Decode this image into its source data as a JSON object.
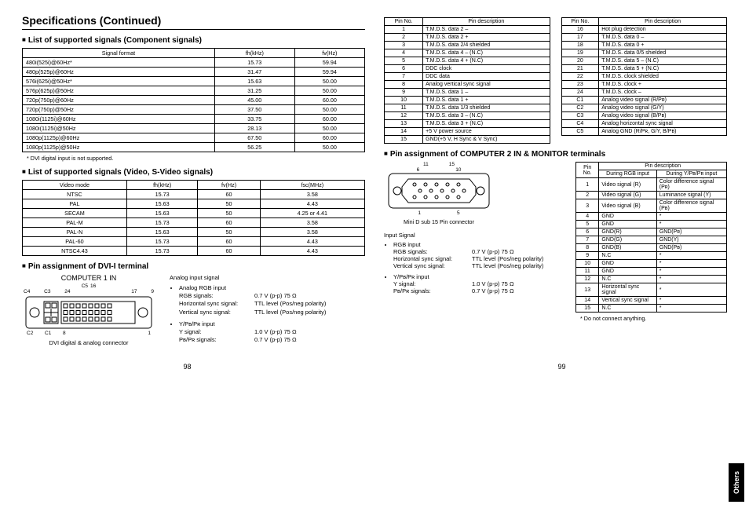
{
  "header": {
    "title": "Specifications (Continued)"
  },
  "left": {
    "componentHeading": "List of supported signals (Component signals)",
    "component": {
      "headers": [
        "Signal format",
        "fh(kHz)",
        "fv(Hz)"
      ],
      "rows": [
        [
          "480i(525i)@60Hz*",
          "15.73",
          "59.94"
        ],
        [
          "480p(525p)@60Hz",
          "31.47",
          "59.94"
        ],
        [
          "576i(625i)@50Hz*",
          "15.63",
          "50.00"
        ],
        [
          "576p(625p)@50Hz",
          "31.25",
          "50.00"
        ],
        [
          "720p(750p)@60Hz",
          "45.00",
          "60.00"
        ],
        [
          "720p(750p)@50Hz",
          "37.50",
          "50.00"
        ],
        [
          "1080i(1125i)@60Hz",
          "33.75",
          "60.00"
        ],
        [
          "1080i(1125i)@50Hz",
          "28.13",
          "50.00"
        ],
        [
          "1080p(1125p)@60Hz",
          "67.50",
          "60.00"
        ],
        [
          "1080p(1125p)@50Hz",
          "56.25",
          "50.00"
        ]
      ],
      "note": "* DVI digital input is not supported."
    },
    "videoHeading": "List of supported signals (Video, S-Video signals)",
    "video": {
      "headers": [
        "Video mode",
        "fh(kHz)",
        "fv(Hz)",
        "fsc(MHz)"
      ],
      "rows": [
        [
          "NTSC",
          "15.73",
          "60",
          "3.58"
        ],
        [
          "PAL",
          "15.63",
          "50",
          "4.43"
        ],
        [
          "SECAM",
          "15.63",
          "50",
          "4.25 or 4.41"
        ],
        [
          "PAL-M",
          "15.73",
          "60",
          "3.58"
        ],
        [
          "PAL-N",
          "15.63",
          "50",
          "3.58"
        ],
        [
          "PAL-60",
          "15.73",
          "60",
          "4.43"
        ],
        [
          "NTSC4.43",
          "15.73",
          "60",
          "4.43"
        ]
      ]
    },
    "dviHeading": "Pin assignment of DVI-I terminal",
    "dvi": {
      "diagramLabel": "COMPUTER 1 IN",
      "diagramCaption": "DVI digital & analog connector",
      "analogTitle": "Analog input signal",
      "rgb": {
        "title": "Analog RGB input",
        "l1k": "RGB signals:",
        "l1v": "0.7 V (p-p) 75 Ω",
        "l2k": "Horizontal sync signal:",
        "l2v": "TTL level (Pos/neg polarity)",
        "l3k": "Vertical sync signal:",
        "l3v": "TTL level (Pos/neg polarity)"
      },
      "ypbpr": {
        "title": "Y/Pʙ/Pʀ input",
        "l1k": "Y signal:",
        "l1v": "1.0 V (p-p) 75 Ω",
        "l2k": "Pʙ/Pʀ signals:",
        "l2v": "0.7 V (p-p) 75 Ω"
      }
    }
  },
  "right": {
    "pinHeaders": [
      "Pin No.",
      "Pin description"
    ],
    "pinsA": [
      [
        "1",
        "T.M.D.S. data 2 –"
      ],
      [
        "2",
        "T.M.D.S. data 2 +"
      ],
      [
        "3",
        "T.M.D.S. data 2/4 shielded"
      ],
      [
        "4",
        "T.M.D.S. data 4 – (N.C)"
      ],
      [
        "5",
        "T.M.D.S. data 4 + (N.C)"
      ],
      [
        "6",
        "DDC clock"
      ],
      [
        "7",
        "DDC data"
      ],
      [
        "8",
        "Analog vertical sync signal"
      ],
      [
        "9",
        "T.M.D.S. data 1 –"
      ],
      [
        "10",
        "T.M.D.S. data 1 +"
      ],
      [
        "11",
        "T.M.D.S. data 1/3 shielded"
      ],
      [
        "12",
        "T.M.D.S. data 3 – (N.C)"
      ],
      [
        "13",
        "T.M.D.S. data 3 + (N.C)"
      ],
      [
        "14",
        "+5 V power source"
      ],
      [
        "15",
        "GND(+5 V, H Sync & V Sync)"
      ]
    ],
    "pinsB": [
      [
        "16",
        "Hot plug detection"
      ],
      [
        "17",
        "T.M.D.S. data 0 –"
      ],
      [
        "18",
        "T.M.D.S. data 0 +"
      ],
      [
        "19",
        "T.M.D.S. data 0/5 shielded"
      ],
      [
        "20",
        "T.M.D.S. data 5 – (N.C)"
      ],
      [
        "21",
        "T.M.D.S. data 5 + (N.C)"
      ],
      [
        "22",
        "T.M.D.S. clock shielded"
      ],
      [
        "23",
        "T.M.D.S. clock +"
      ],
      [
        "24",
        "T.M.D.S. clock –"
      ],
      [
        "C1",
        "Analog video signal (R/Pʀ)"
      ],
      [
        "C2",
        "Analog video signal (G/Y)"
      ],
      [
        "C3",
        "Analog video signal (B/Pʙ)"
      ],
      [
        "C4",
        "Analog horizontal sync signal"
      ],
      [
        "C5",
        "Analog GND (R/Pʀ, G/Y, B/Pʙ)"
      ]
    ],
    "comp2Heading": "Pin assignment of COMPUTER 2 IN & MONITOR terminals",
    "d15": {
      "caption": "Mini D sub 15 Pin connector"
    },
    "input": {
      "title": "Input Signal",
      "rgb": {
        "title": "RGB input",
        "l1k": "RGB signals:",
        "l1v": "0.7 V (p-p) 75 Ω",
        "l2k": "Horizontal sync signal:",
        "l2v": "TTL level (Pos/neg polarity)",
        "l3k": "Vertical sync signal:",
        "l3v": "TTL level (Pos/neg polarity)"
      },
      "ypbpr": {
        "title": "Y/Pʙ/Pʀ input",
        "l1k": "Y signal:",
        "l1v": "1.0 V (p-p) 75 Ω",
        "l2k": "Pʙ/Pʀ signals:",
        "l2v": "0.7 V (p-p) 75 Ω"
      }
    },
    "d15table": {
      "h0": "Pin No.",
      "h1": "Pin description",
      "h2": "During RGB input",
      "h3": "During Y/Pʙ/Pʀ input",
      "rows": [
        [
          "1",
          "Video signal (R)",
          "Color difference signal (Pʀ)"
        ],
        [
          "2",
          "Video signal (G)",
          "Luminance signal (Y)"
        ],
        [
          "3",
          "Video signal (B)",
          "Color difference signal (Pʙ)"
        ],
        [
          "4",
          "GND",
          "*"
        ],
        [
          "5",
          "GND",
          "*"
        ],
        [
          "6",
          "GND(R)",
          "GND(Pʀ)"
        ],
        [
          "7",
          "GND(G)",
          "GND(Y)"
        ],
        [
          "8",
          "GND(B)",
          "GND(Pʙ)"
        ],
        [
          "9",
          "N.C",
          "*"
        ],
        [
          "10",
          "GND",
          "*"
        ],
        [
          "11",
          "GND",
          "*"
        ],
        [
          "12",
          "N.C",
          "*"
        ],
        [
          "13",
          "Horizontal sync signal",
          "*"
        ],
        [
          "14",
          "Vertical sync signal",
          "*"
        ],
        [
          "15",
          "N.C",
          "*"
        ]
      ],
      "note": "* Do not connect anything."
    }
  },
  "footer": {
    "left": "98",
    "right": "99"
  },
  "sidetab": "Others"
}
